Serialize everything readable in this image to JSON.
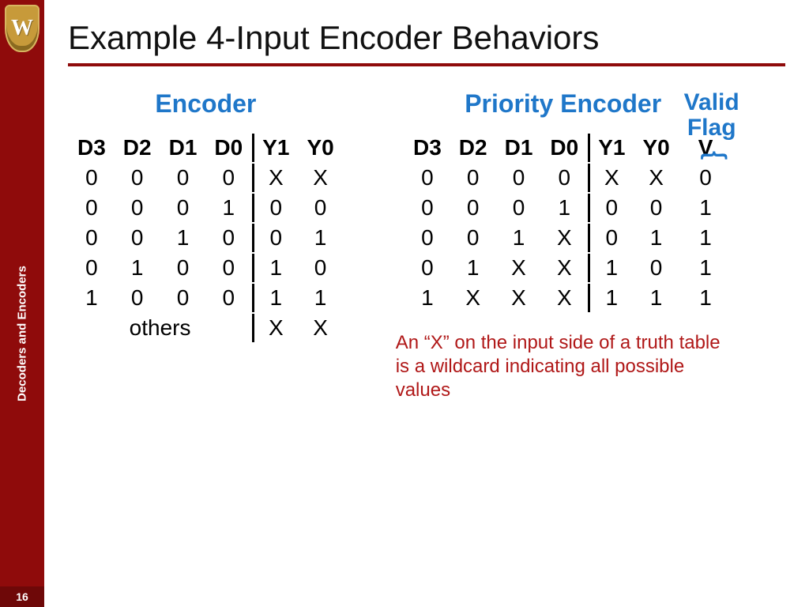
{
  "sidebar": {
    "crest_letter": "W",
    "label": "Decoders and Encoders",
    "page_number": "16"
  },
  "title": "Example 4-Input Encoder Behaviors",
  "encoder": {
    "title": "Encoder",
    "headers": [
      "D3",
      "D2",
      "D1",
      "D0",
      "Y1",
      "Y0"
    ],
    "rows": [
      [
        "0",
        "0",
        "0",
        "0",
        "X",
        "X"
      ],
      [
        "0",
        "0",
        "0",
        "1",
        "0",
        "0"
      ],
      [
        "0",
        "0",
        "1",
        "0",
        "0",
        "1"
      ],
      [
        "0",
        "1",
        "0",
        "0",
        "1",
        "0"
      ],
      [
        "1",
        "0",
        "0",
        "0",
        "1",
        "1"
      ]
    ],
    "others_label": "others",
    "others_out": [
      "X",
      "X"
    ]
  },
  "priority": {
    "title": "Priority Encoder",
    "valid_flag_label": "Valid Flag",
    "headers": [
      "D3",
      "D2",
      "D1",
      "D0",
      "Y1",
      "Y0",
      "V"
    ],
    "rows": [
      [
        "0",
        "0",
        "0",
        "0",
        "X",
        "X",
        "0"
      ],
      [
        "0",
        "0",
        "0",
        "1",
        "0",
        "0",
        "1"
      ],
      [
        "0",
        "0",
        "1",
        "X",
        "0",
        "1",
        "1"
      ],
      [
        "0",
        "1",
        "X",
        "X",
        "1",
        "0",
        "1"
      ],
      [
        "1",
        "X",
        "X",
        "X",
        "1",
        "1",
        "1"
      ]
    ]
  },
  "note": "An “X” on the input side of a truth table is a wildcard indicating all possible values"
}
